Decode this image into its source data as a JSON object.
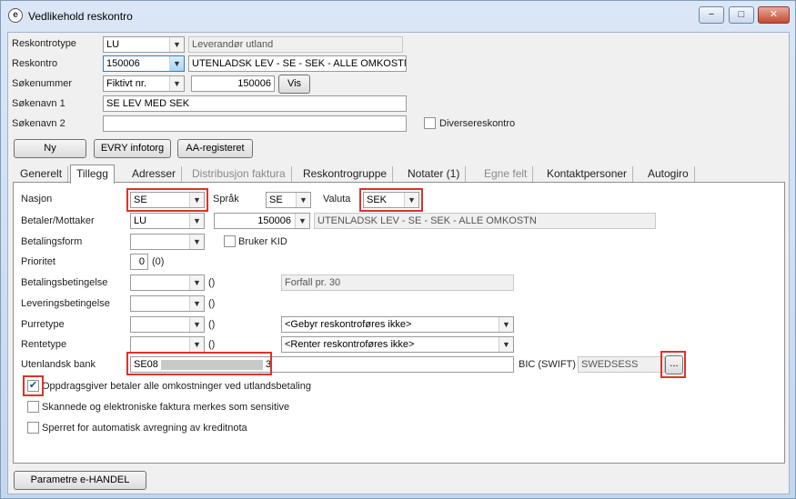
{
  "window": {
    "title": "Vedlikehold reskontro",
    "app_icon_glyph": "e",
    "controls": {
      "minimize": "−",
      "maximize": "□",
      "close": "✕"
    }
  },
  "header": {
    "reskontrotype": {
      "label": "Reskontrotype",
      "value": "LU",
      "description": "Leverandør utland"
    },
    "reskontro": {
      "label": "Reskontro",
      "value": "150006",
      "description": "UTENLADSK LEV - SE - SEK - ALLE OMKOSTN"
    },
    "sokenummer": {
      "label": "Søkenummer",
      "type_value": "Fiktivt nr.",
      "value": "150006",
      "button": "Vis"
    },
    "sokenavn1": {
      "label": "Søkenavn 1",
      "value": "SE LEV MED SEK"
    },
    "sokenavn2": {
      "label": "Søkenavn 2",
      "value": ""
    },
    "diversereskontro": {
      "label": "Diversereskontro",
      "checked": false
    }
  },
  "actions": {
    "ny": "Ny",
    "evry": "EVRY infotorg",
    "aa": "AA-registeret"
  },
  "tabs": [
    {
      "label": "Generelt",
      "state": "normal"
    },
    {
      "label": "Tillegg",
      "state": "active"
    },
    {
      "label": "Adresser",
      "state": "normal"
    },
    {
      "label": "Distribusjon faktura",
      "state": "disabled"
    },
    {
      "label": "Reskontrogruppe",
      "state": "normal"
    },
    {
      "label": "Notater (1)",
      "state": "normal"
    },
    {
      "label": "Egne felt",
      "state": "disabled"
    },
    {
      "label": "Kontaktpersoner",
      "state": "normal"
    },
    {
      "label": "Autogiro",
      "state": "normal"
    }
  ],
  "tillegg": {
    "nasjon": {
      "label": "Nasjon",
      "value": "SE"
    },
    "sprak": {
      "label": "Språk",
      "value": "SE"
    },
    "valuta": {
      "label": "Valuta",
      "value": "SEK"
    },
    "betaler": {
      "label": "Betaler/Mottaker",
      "type_value": "LU",
      "value": "150006",
      "description": "UTENLADSK LEV - SE - SEK - ALLE OMKOSTN"
    },
    "betalingsform": {
      "label": "Betalingsform",
      "value": ""
    },
    "bruker_kid": {
      "label": "Bruker KID",
      "checked": false
    },
    "prioritet": {
      "label": "Prioritet",
      "value": "0",
      "note": "(0)"
    },
    "betalingsbetingelse": {
      "label": "Betalingsbetingelse",
      "value": "",
      "paren": "()",
      "description": "Forfall pr. 30"
    },
    "leveringsbetingelse": {
      "label": "Leveringsbetingelse",
      "value": "",
      "paren": "()"
    },
    "purretype": {
      "label": "Purretype",
      "value": "",
      "paren": "()",
      "option": "<Gebyr reskontroføres ikke>"
    },
    "rentetype": {
      "label": "Rentetype",
      "value": "",
      "paren": "()",
      "option": "<Renter reskontroføres ikke>"
    },
    "utenlandsk_bank": {
      "label": "Utenlandsk bank",
      "value_start": "SE08",
      "value_end": "3"
    },
    "bic": {
      "label": "BIC (SWIFT)",
      "value": "SWEDSESS",
      "button": "..."
    },
    "checks": [
      {
        "label": "Oppdragsgiver betaler alle omkostninger ved utlandsbetaling",
        "checked": true
      },
      {
        "label": "Skannede og elektroniske faktura merkes som sensitive",
        "checked": false
      },
      {
        "label": "Sperret for automatisk avregning av kreditnota",
        "checked": false
      }
    ]
  },
  "footer": {
    "parametre": "Parametre e-HANDEL"
  },
  "colors": {
    "highlight": "#d9342b",
    "accent": "#3c7fb1"
  }
}
